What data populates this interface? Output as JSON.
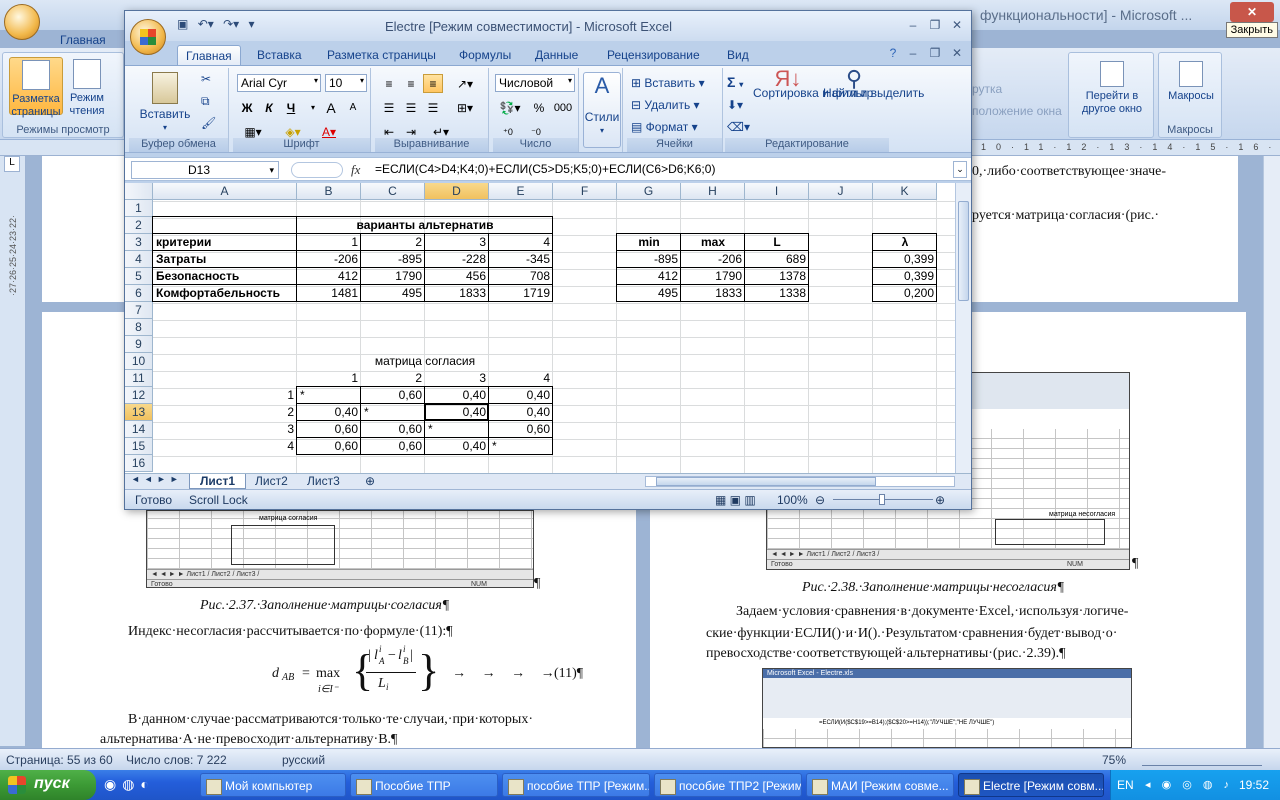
{
  "word": {
    "title": "функциональности] - Microsoft ...",
    "close_tooltip": "Закрыть",
    "tab_home": "Главная",
    "ribbon": {
      "layout_btn": "Разметка страницы",
      "reading_btn": "Режим чтения",
      "group_views": "Режимы просмотр",
      "frag_1": "рутка",
      "frag_2": "положение окна",
      "goto_btn": "Перейти в другое окно",
      "macros_btn": "Макросы",
      "group_macros": "Макросы"
    },
    "ruler_marks": [
      "10",
      "11",
      "12",
      "13",
      "14",
      "15",
      "16",
      "17"
    ],
    "vruler_marks": [
      "1",
      "22",
      "23",
      "24",
      "25",
      "26",
      "27"
    ],
    "doc": {
      "line_top_1": "0,·либо·соответствующее·значе-",
      "line_top_2": "руется·матрица·согласия·(рис.·",
      "fig237": "Рис.·2.37.·Заполнение·матрицы·согласия¶",
      "index_text": "Индекс·несогласия·рассчитывается·по·формуле·(11):¶",
      "formula_lhs": "d",
      "formula_sub": "AB",
      "formula_max": "max",
      "formula_under": "i∈I⁻",
      "formula_num": "l",
      "formula_num_sup": "i",
      "formula_num_sub": "A",
      "formula_minus": "−",
      "formula_num2": "l",
      "formula_num2_sup": "i",
      "formula_num2_sub": "B",
      "formula_den": "L",
      "formula_den_sub": "i",
      "formula_tail": "· → → → →",
      "formula_no": "(11)¶",
      "para_1": "В·данном·случае·рассматриваются·только·те·случаи,·при·которых·",
      "para_2": "альтернатива·A·не·превосходит·альтернативу·B.¶",
      "fig238": "Рис.·2.38.·Заполнение·матрицы·несогласия¶",
      "right_1": "Задаем·условия·сравнения·в·документе·Excel,·используя·логиче-",
      "right_2": "ские·функции·ЕСЛИ()·и·И().·Результатом·сравнения·будет·вывод·о·",
      "right_3": "превосходстве·соответствующей·альтернативы·(рис.·2.39).¶",
      "pilcrow": "¶"
    },
    "thumb1": {
      "title": "матрица согласия",
      "tabs": "◄ ◄ ► ► Лист1 / Лист2 / Лист3 /",
      "status_left": "Готово",
      "status_right": "NUM"
    },
    "thumb2": {
      "tabs": "◄ ◄ ► ► Лист1 / Лист2 / Лист3 /",
      "status_left": "Готово",
      "status_right": "NUM",
      "title": "матрица несогласия"
    },
    "thumb3": {
      "title": "Microsoft Excel - Electre.xls",
      "formula": "=ЕСЛИ(И($C$19>=B14);($C$20>=H14));\"ЛУЧШЕ\";\"НЕ ЛУЧШЕ\")"
    },
    "status": {
      "page": "Страница: 55 из 60",
      "words": "Число слов: 7 222",
      "lang": "русский",
      "zoom": "75%"
    }
  },
  "excel": {
    "title": "Electre  [Режим совместимости] - Microsoft Excel",
    "tabs": [
      "Главная",
      "Вставка",
      "Разметка страницы",
      "Формулы",
      "Данные",
      "Рецензирование",
      "Вид"
    ],
    "ribbon": {
      "paste": "Вставить",
      "clipboard": "Буфер обмена",
      "font_name": "Arial Cyr",
      "font_size": "10",
      "bold": "Ж",
      "italic": "К",
      "underline": "Ч",
      "grow": "A",
      "shrink": "A",
      "font_group": "Шрифт",
      "align_group": "Выравнивание",
      "number_format": "Числовой",
      "percent": "%",
      "thousands": "000",
      "number_group": "Число",
      "styles": "Стили",
      "insert": "Вставить",
      "delete": "Удалить",
      "format": "Формат",
      "cells_group": "Ячейки",
      "sigma": "Σ",
      "sort": "Сортировка и фильтр",
      "find": "Найти и выделить",
      "edit_group": "Редактирование"
    },
    "namebox": "D13",
    "fx": "fx",
    "formula": "=ЕСЛИ(C4>D4;K4;0)+ЕСЛИ(C5>D5;K5;0)+ЕСЛИ(C6>D6;K6;0)",
    "columns": [
      "A",
      "B",
      "C",
      "D",
      "E",
      "F",
      "G",
      "H",
      "I",
      "J",
      "K"
    ],
    "rows": [
      "1",
      "2",
      "3",
      "4",
      "5",
      "6",
      "7",
      "8",
      "9",
      "10",
      "11",
      "12",
      "13",
      "14",
      "15",
      "16"
    ],
    "cells": {
      "b2": "варианты альтернатив",
      "a3": "критерии",
      "b3": "1",
      "c3": "2",
      "d3": "3",
      "e3": "4",
      "g3": "min",
      "h3": "max",
      "i3": "L",
      "k3": "λ",
      "a4": "Затраты",
      "b4": "-206",
      "c4": "-895",
      "d4": "-228",
      "e4": "-345",
      "g4": "-895",
      "h4": "-206",
      "i4": "689",
      "k4": "0,399",
      "a5": "Безопасность",
      "b5": "412",
      "c5": "1790",
      "d5": "456",
      "e5": "708",
      "g5": "412",
      "h5": "1790",
      "i5": "1378",
      "k5": "0,399",
      "a6": "Комфортабельность",
      "b6": "1481",
      "c6": "495",
      "d6": "1833",
      "e6": "1719",
      "g6": "495",
      "h6": "1833",
      "i6": "1338",
      "k6": "0,200",
      "c10": "матрица согласия",
      "b11": "1",
      "c11": "2",
      "d11": "3",
      "e11": "4",
      "a12": "1",
      "b12": "*",
      "c12": "0,60",
      "d12": "0,40",
      "e12": "0,40",
      "a13": "2",
      "b13": "0,40",
      "c13": "*",
      "d13": "0,40",
      "e13": "0,40",
      "a14": "3",
      "b14": "0,60",
      "c14": "0,60",
      "d14": "*",
      "e14": "0,60",
      "a15": "4",
      "b15": "0,60",
      "c15": "0,60",
      "d15": "0,40",
      "e15": "*"
    },
    "sheets": [
      "Лист1",
      "Лист2",
      "Лист3"
    ],
    "status_ready": "Готово",
    "status_scroll": "Scroll Lock",
    "zoom": "100%"
  },
  "taskbar": {
    "start": "пуск",
    "items": [
      "Мой компьютер",
      "Пособие ТПР",
      "пособие ТПР [Режим...",
      "пособие ТПР2 [Режим...",
      "МАИ  [Режим совме...",
      "Electre  [Режим совм..."
    ],
    "lang": "EN",
    "clock": "19:52"
  }
}
